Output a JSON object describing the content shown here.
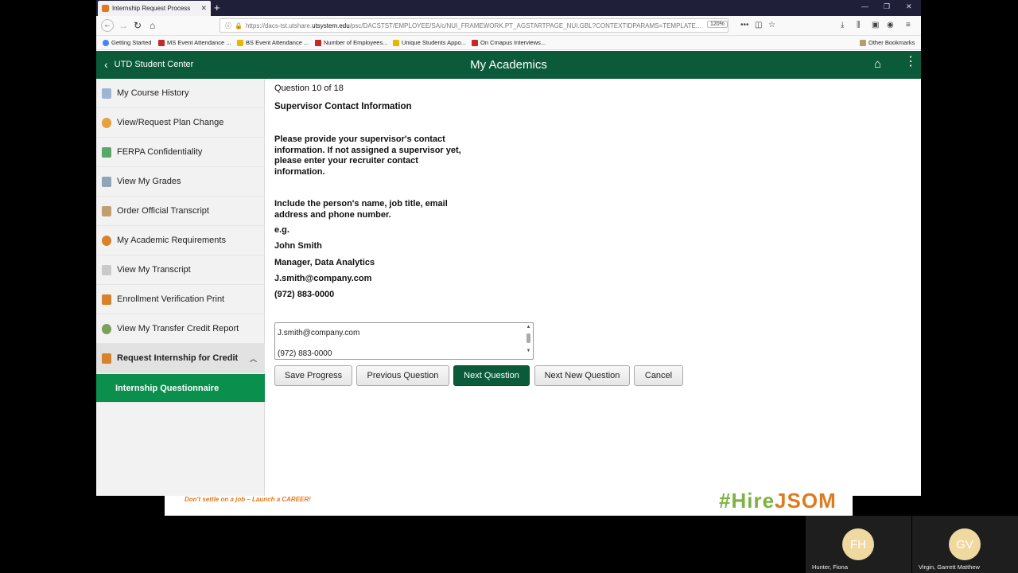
{
  "browser": {
    "tab_title": "Internship Request Process",
    "url_prefix": "https://dacs-tst.utshare.",
    "url_domain": "utsystem.edu",
    "url_path": "/psc/DACSTST/EMPLOYEE/SA/c/NUI_FRAMEWORK.PT_AGSTARTPAGE_NUI.GBL?CONTEXTIDPARAMS=TEMPLATE...",
    "zoom": "120%",
    "bookmarks": [
      {
        "label": "Getting Started",
        "icon": "google-icon"
      },
      {
        "label": "MS Event Attendance ...",
        "icon": "red"
      },
      {
        "label": "BS Event Attendance ...",
        "icon": "yellow"
      },
      {
        "label": "Number of Employees...",
        "icon": "red"
      },
      {
        "label": "Unique Students Appo...",
        "icon": "yellow"
      },
      {
        "label": "On Cmapus Interviews...",
        "icon": "red"
      }
    ],
    "other_bookmarks": "Other Bookmarks"
  },
  "header": {
    "back_label": "UTD Student Center",
    "title": "My Academics"
  },
  "sidebar": {
    "items": [
      {
        "label": "My Course History",
        "color": "#9bb7d4"
      },
      {
        "label": "View/Request Plan Change",
        "color": "#e6a23c"
      },
      {
        "label": "FERPA Confidentiality",
        "color": "#5aa869"
      },
      {
        "label": "View My Grades",
        "color": "#8fa6b8"
      },
      {
        "label": "Order Official Transcript",
        "color": "#c0a070"
      },
      {
        "label": "My Academic Requirements",
        "color": "#d9822b"
      },
      {
        "label": "View My Transcript",
        "color": "#c9c9c9"
      },
      {
        "label": "Enrollment Verification Print",
        "color": "#d9822b"
      },
      {
        "label": "View My Transfer Credit Report",
        "color": "#7aa05a"
      },
      {
        "label": "Request Internship for Credit",
        "color": "#d9822b"
      }
    ],
    "sub_item": "Internship Questionnaire"
  },
  "main": {
    "question_counter": "Question 10 of 18",
    "section_title": "Supervisor Contact Information",
    "instructions_1": [
      "Please provide your supervisor's contact",
      "information.  If not assigned a supervisor yet,",
      "please enter your recruiter contact",
      "information."
    ],
    "instructions_2": [
      "Include the person's name, job title, email",
      "address and phone number."
    ],
    "example_label": "e.g.",
    "example_name": "John Smith",
    "example_title": "Manager, Data Analytics",
    "example_email": "J.smith@company.com",
    "example_phone": "(972) 883-0000",
    "answer_line_1": "J.smith@company.com",
    "answer_line_2": "(972) 883-0000",
    "buttons": {
      "save": "Save Progress",
      "previous": "Previous Question",
      "next": "Next Question",
      "next_new": "Next New Question",
      "cancel": "Cancel"
    }
  },
  "banner": {
    "slogan": "Don't settle on a job – Launch a CAREER!"
  },
  "participants": [
    {
      "initials": "FH",
      "name": "Hunter, Fiona"
    },
    {
      "initials": "GV",
      "name": "Virgin, Garrett Matthew"
    }
  ]
}
